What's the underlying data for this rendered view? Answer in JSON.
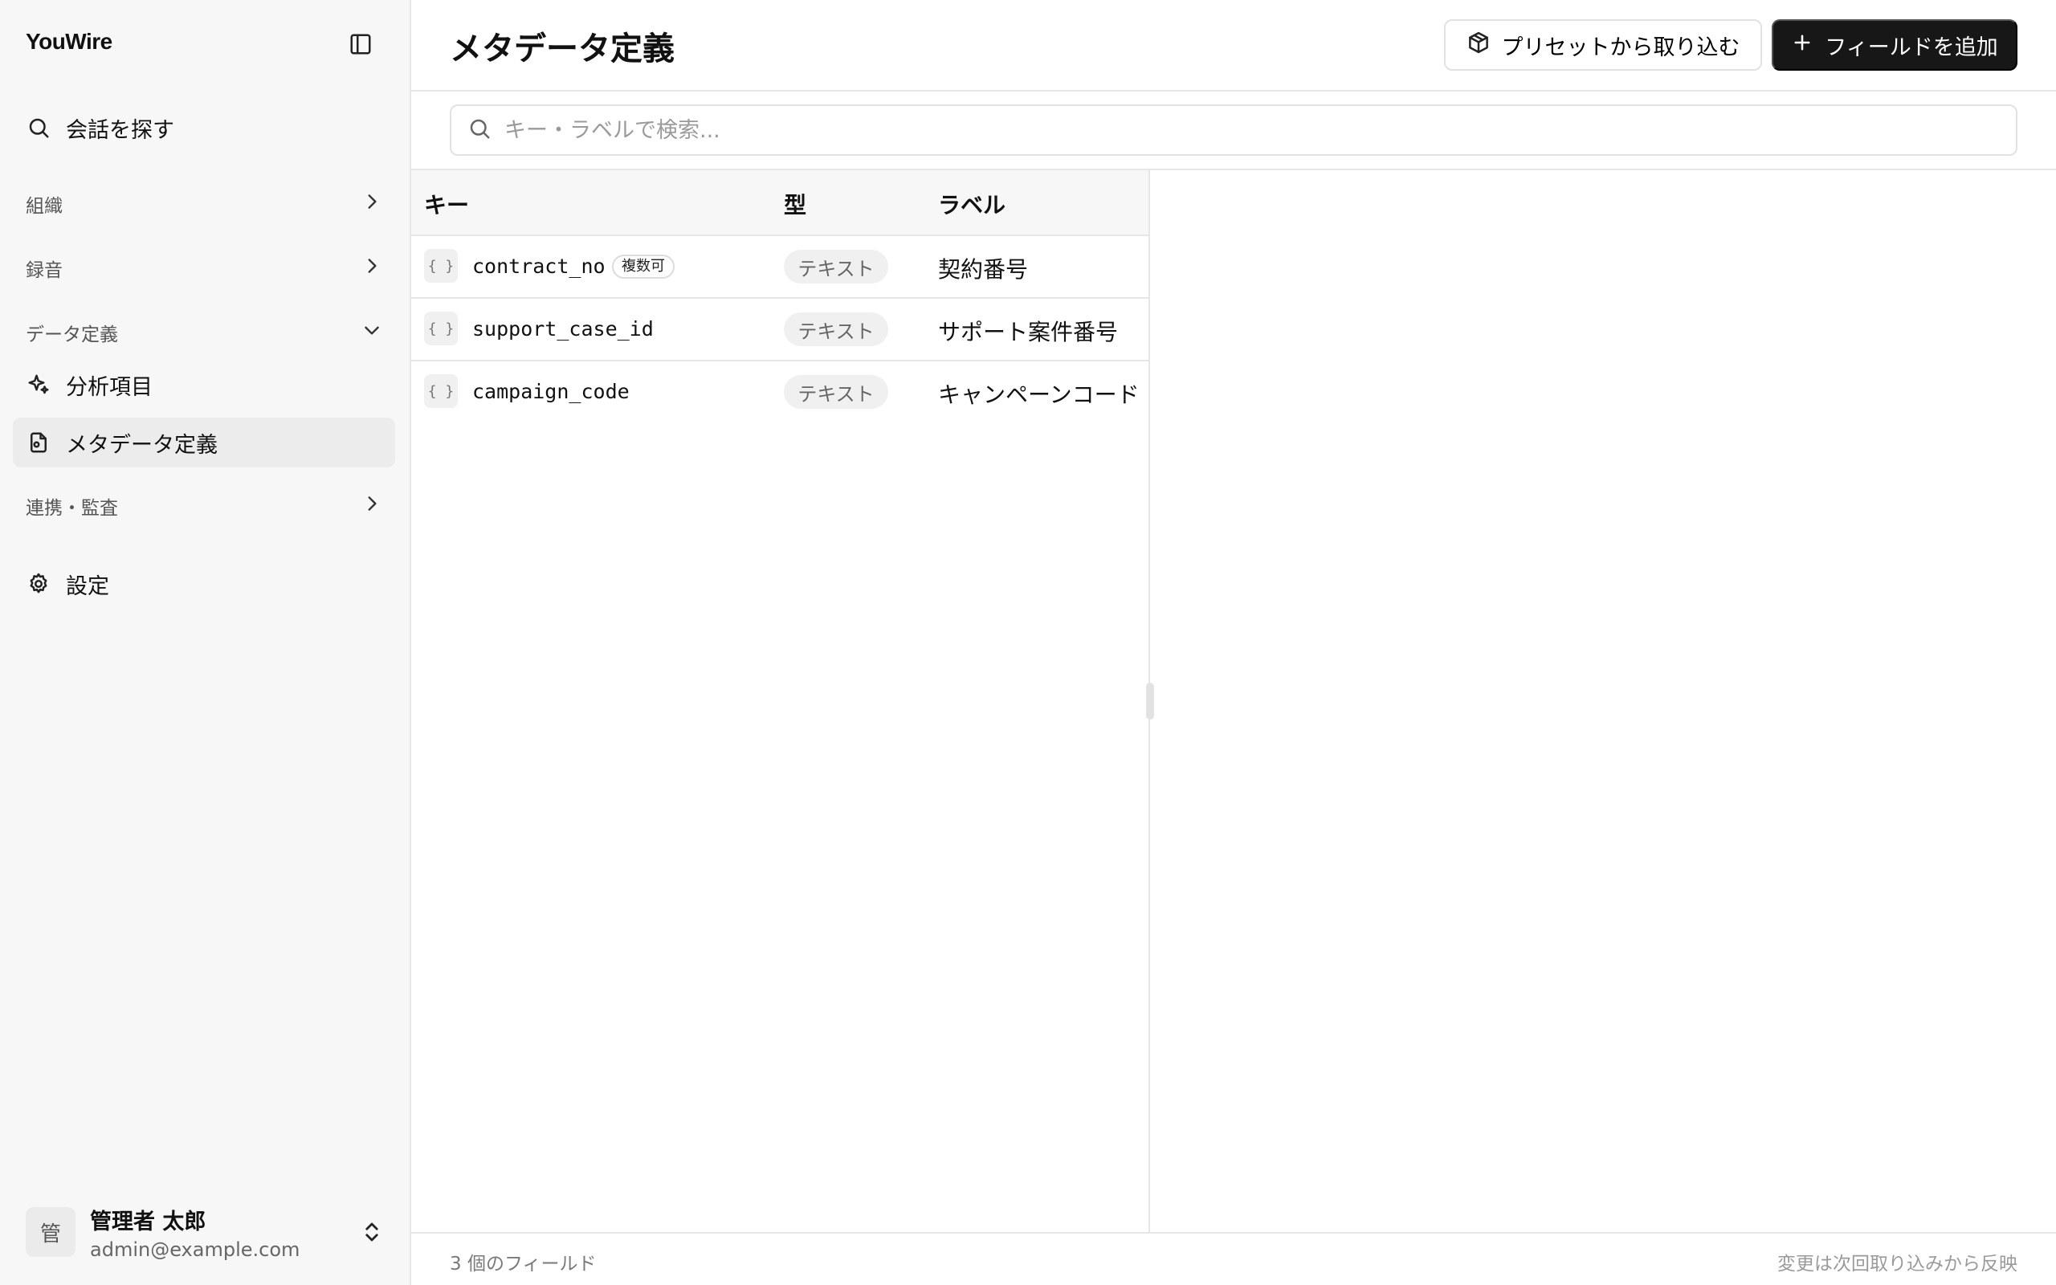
{
  "app": {
    "brand": "YouWire"
  },
  "sidebar": {
    "search_label": "会話を探す",
    "groups": {
      "org": "組織",
      "recording": "録音",
      "data_def": "データ定義",
      "integration": "連携・監査"
    },
    "items": {
      "analysis": "分析項目",
      "metadata": "メタデータ定義",
      "settings": "設定"
    },
    "user": {
      "avatar": "管",
      "name": "管理者 太郎",
      "email": "admin@example.com"
    }
  },
  "header": {
    "title": "メタデータ定義",
    "preset_button": "プリセットから取り込む",
    "add_button": "フィールドを追加"
  },
  "search": {
    "placeholder": "キー・ラベルで検索...",
    "value": ""
  },
  "table": {
    "columns": {
      "key": "キー",
      "type": "型",
      "label": "ラベル"
    },
    "rows": [
      {
        "icon": "{ }",
        "key": "contract_no",
        "badge": "複数可",
        "type": "テキスト",
        "label": "契約番号"
      },
      {
        "icon": "{ }",
        "key": "support_case_id",
        "badge": "",
        "type": "テキスト",
        "label": "サポート案件番号"
      },
      {
        "icon": "{ }",
        "key": "campaign_code",
        "badge": "",
        "type": "テキスト",
        "label": "キャンペーンコード"
      }
    ]
  },
  "footer": {
    "count": "3 個のフィールド",
    "note": "変更は次回取り込みから反映"
  },
  "colors": {
    "sidebar_bg": "#f7f7f7",
    "active_item_bg": "#ececec",
    "primary_button": "#171717",
    "border": "#e6e6e6"
  },
  "icons": {
    "sidebar_toggle": "panel-left-icon",
    "search": "search-icon",
    "chevron_right": "chevron-right-icon",
    "chevron_down": "chevron-down-icon",
    "analysis": "sparkles-icon",
    "metadata": "file-icon",
    "settings": "gear-icon",
    "preset": "package-icon",
    "add": "plus-icon",
    "user_switch": "chevrons-up-down-icon",
    "key": "braces-icon"
  }
}
